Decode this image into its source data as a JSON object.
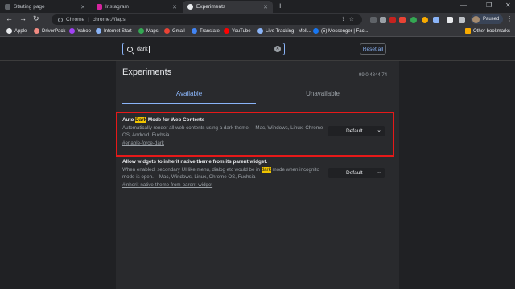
{
  "tabs": [
    {
      "label": "Starting page",
      "active": false
    },
    {
      "label": "Instagram",
      "active": false
    },
    {
      "label": "Experiments",
      "active": true
    }
  ],
  "omnibox": {
    "scheme": "Chrome",
    "url": "chrome://flags"
  },
  "profile": {
    "label": "Paused"
  },
  "bookmarks": [
    {
      "label": "Apple",
      "color": "#e8eaed"
    },
    {
      "label": "DriverPack",
      "color": "#f28b82"
    },
    {
      "label": "Yahoo",
      "color": "#a142f4"
    },
    {
      "label": "Internet Start",
      "color": "#8ab4f8"
    },
    {
      "label": "Maps",
      "color": "#34a853"
    },
    {
      "label": "Gmail",
      "color": "#ea4335"
    },
    {
      "label": "Translate",
      "color": "#4285f4"
    },
    {
      "label": "YouTube",
      "color": "#ff0000"
    },
    {
      "label": "Live Tracking - Mell...",
      "color": "#8ab4f8"
    },
    {
      "label": "(5) Messenger | Fac...",
      "color": "#1877f2"
    }
  ],
  "other_bookmarks": "Other bookmarks",
  "search": {
    "value": "dark"
  },
  "reset_label": "Reset all",
  "page_title": "Experiments",
  "version": "99.0.4844.74",
  "page_tabs": {
    "available": "Available",
    "unavailable": "Unavailable"
  },
  "experiments": [
    {
      "name_pre": "Auto ",
      "name_hl": "Dark",
      "name_post": " Mode for Web Contents",
      "desc": "Automatically render all web contents using a dark theme. – Mac, Windows, Linux, Chrome OS, Android, Fuchsia",
      "link": "#enable-force-dark",
      "value": "Default"
    },
    {
      "name": "Allow widgets to inherit native theme from its parent widget.",
      "desc_pre": "When enabled, secondary UI like menu, dialog etc would be in ",
      "desc_hl": "dark",
      "desc_post": " mode when incognito mode is open. – Mac, Windows, Linux, Chrome OS, Fuchsia",
      "link": "#inherit-native-theme-from-parent-widget",
      "value": "Default"
    }
  ]
}
